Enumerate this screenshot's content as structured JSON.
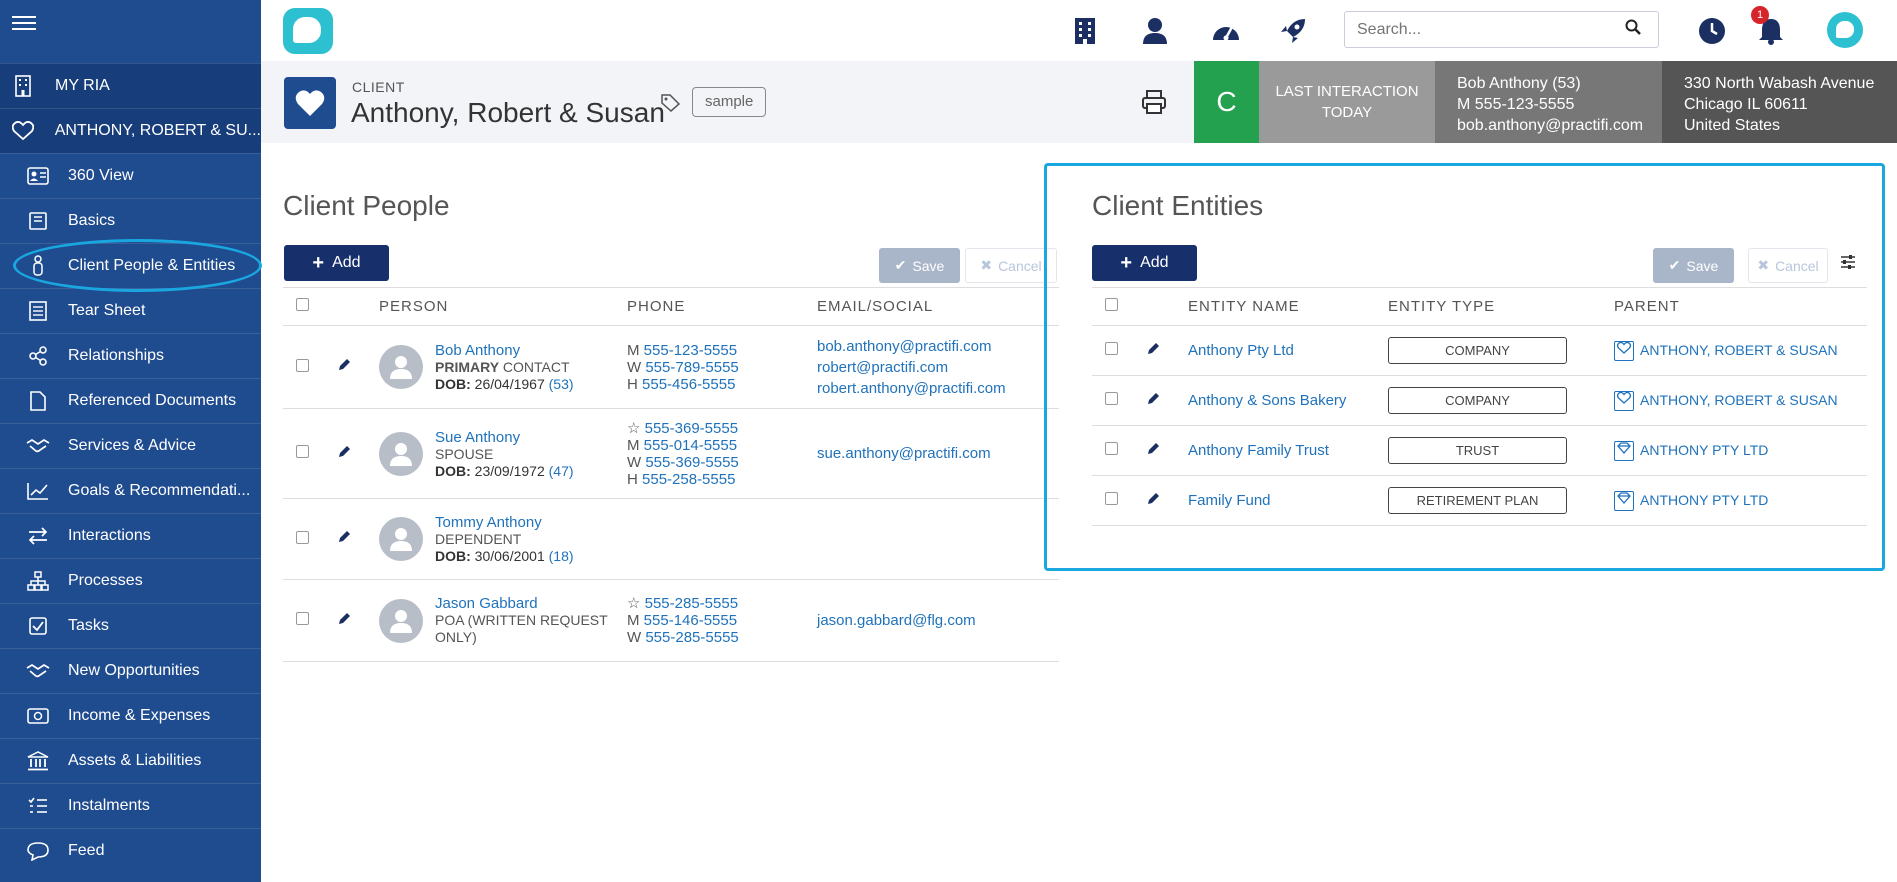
{
  "sidebar": {
    "top_items": [
      {
        "label": "MY RIA",
        "icon": "building-icon"
      },
      {
        "label": "ANTHONY, ROBERT & SU...",
        "icon": "heart-icon"
      }
    ],
    "items": [
      {
        "label": "360 View",
        "icon": "id-card-icon"
      },
      {
        "label": "Basics",
        "icon": "book-icon"
      },
      {
        "label": "Client People & Entities",
        "icon": "person-icon"
      },
      {
        "label": "Tear Sheet",
        "icon": "list-icon"
      },
      {
        "label": "Relationships",
        "icon": "share-icon"
      },
      {
        "label": "Referenced Documents",
        "icon": "document-icon"
      },
      {
        "label": "Services & Advice",
        "icon": "handshake-icon"
      },
      {
        "label": "Goals & Recommendati...",
        "icon": "chart-line-icon"
      },
      {
        "label": "Interactions",
        "icon": "arrows-icon"
      },
      {
        "label": "Processes",
        "icon": "hierarchy-icon"
      },
      {
        "label": "Tasks",
        "icon": "checkbox-icon"
      },
      {
        "label": "New Opportunities",
        "icon": "handshake-icon"
      },
      {
        "label": "Income & Expenses",
        "icon": "money-icon"
      },
      {
        "label": "Assets & Liabilities",
        "icon": "bank-icon"
      },
      {
        "label": "Instalments",
        "icon": "checklist-icon"
      },
      {
        "label": "Feed",
        "icon": "chat-icon"
      }
    ]
  },
  "topbar": {
    "search_placeholder": "Search...",
    "notification_count": "1"
  },
  "header": {
    "kind": "CLIENT",
    "title": "Anthony, Robert & Susan",
    "tag": "sample",
    "status_letter": "C",
    "last_interaction_label": "LAST INTERACTION",
    "last_interaction_value": "TODAY",
    "contact_name": "Bob Anthony (53)",
    "contact_phone": "M 555-123-5555",
    "contact_email": "bob.anthony@practifi.com",
    "address_line1": "330 North Wabash Avenue",
    "address_line2": "Chicago IL 60611",
    "address_line3": "United States"
  },
  "people": {
    "title": "Client People",
    "add_label": "Add",
    "save_label": "Save",
    "cancel_label": "Cancel",
    "columns": [
      "PERSON",
      "PHONE",
      "EMAIL/SOCIAL"
    ],
    "rows": [
      {
        "name": "Bob Anthony",
        "role_bold": "PRIMARY",
        "role_rest": " CONTACT",
        "dob_label": "DOB:",
        "dob": "26/04/1967",
        "age": "(53)",
        "phones": [
          [
            "M",
            "555-123-5555"
          ],
          [
            "W",
            "555-789-5555"
          ],
          [
            "H",
            "555-456-5555"
          ]
        ],
        "emails": [
          "bob.anthony@practifi.com",
          "robert@practifi.com",
          "robert.anthony@practifi.com"
        ]
      },
      {
        "name": "Sue Anthony",
        "role_bold": "",
        "role_rest": "SPOUSE",
        "dob_label": "DOB:",
        "dob": "23/09/1972",
        "age": "(47)",
        "phones": [
          [
            "☆",
            "555-369-5555"
          ],
          [
            "M",
            "555-014-5555"
          ],
          [
            "W",
            "555-369-5555"
          ],
          [
            "H",
            "555-258-5555"
          ]
        ],
        "emails": [
          "sue.anthony@practifi.com"
        ]
      },
      {
        "name": "Tommy Anthony",
        "role_bold": "",
        "role_rest": "DEPENDENT",
        "dob_label": "DOB:",
        "dob": "30/06/2001",
        "age": "(18)",
        "phones": [],
        "emails": []
      },
      {
        "name": "Jason Gabbard",
        "role_bold": "",
        "role_rest": "POA (WRITTEN REQUEST ONLY)",
        "dob_label": "",
        "dob": "",
        "age": "",
        "phones": [
          [
            "☆",
            "555-285-5555"
          ],
          [
            "M",
            "555-146-5555"
          ],
          [
            "W",
            "555-285-5555"
          ]
        ],
        "emails": [
          "jason.gabbard@flg.com"
        ]
      }
    ]
  },
  "entities": {
    "title": "Client Entities",
    "add_label": "Add",
    "save_label": "Save",
    "cancel_label": "Cancel",
    "columns": [
      "ENTITY NAME",
      "ENTITY TYPE",
      "PARENT"
    ],
    "rows": [
      {
        "name": "Anthony Pty Ltd",
        "type": "COMPANY",
        "parent": "ANTHONY, ROBERT & SUSAN",
        "parent_icon": "heart-icon"
      },
      {
        "name": "Anthony & Sons Bakery",
        "type": "COMPANY",
        "parent": "ANTHONY, ROBERT & SUSAN",
        "parent_icon": "heart-icon"
      },
      {
        "name": "Anthony Family Trust",
        "type": "TRUST",
        "parent": "ANTHONY PTY LTD",
        "parent_icon": "diamond-icon"
      },
      {
        "name": "Family Fund",
        "type": "RETIREMENT PLAN",
        "parent": "ANTHONY PTY LTD",
        "parent_icon": "diamond-icon"
      }
    ]
  },
  "colors": {
    "sidebar": "#1f4b8f",
    "accent": "#1aa7e0",
    "primary_button": "#17306b",
    "status_green": "#23a14f",
    "link": "#1f72bb"
  }
}
